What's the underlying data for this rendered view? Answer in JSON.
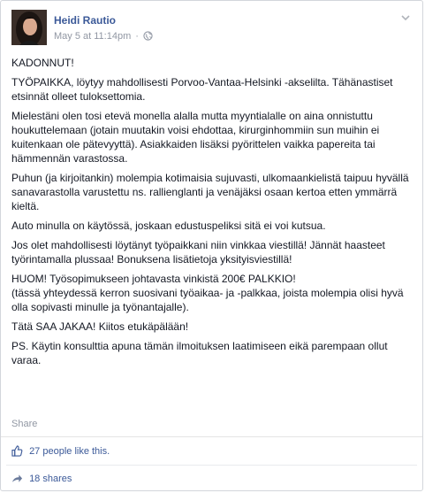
{
  "author": {
    "name": "Heidi Rautio",
    "timestamp": "May 5 at 11:14pm",
    "separator": "·"
  },
  "post": {
    "paragraphs": [
      "KADONNUT!",
      "TYÖPAIKKA, löytyy mahdollisesti Porvoo-Vantaa-Helsinki -akselilta. Tähänastiset etsinnät olleet tuloksettomia.",
      "Mielestäni olen tosi etevä monella alalla mutta myyntialalle on aina onnistuttu houkuttelemaan (jotain muutakin voisi ehdottaa, kirurginhommiin sun muihin ei kuitenkaan ole pätevyyttä). Asiakkaiden lisäksi pyörittelen vaikka papereita tai hämmennän varastossa.",
      "Puhun (ja kirjoitankin) molempia kotimaisia sujuvasti, ulkomaankielistä taipuu hyvällä sanavarastolla varustettu ns. rallienglanti ja venäjäksi osaan kertoa etten ymmärrä kieltä.",
      "Auto minulla on käytössä, joskaan edustuspeliksi sitä ei voi kutsua.",
      "Jos olet mahdollisesti löytänyt työpaikkani niin vinkkaa viestillä! Jännät haasteet työrintamalla plussaa! Bonuksena lisätietoja yksityisviestillä!",
      "HUOM! Työsopimukseen johtavasta vinkistä 200€ PALKKIO!\n(tässä yhteydessä kerron suosivani työaikaa- ja -palkkaa, joista molempia olisi hyvä olla sopivasti minulle ja työnantajalle).",
      "Tätä SAA JAKAA! Kiitos etukäpälään!",
      "PS. Käytin konsulttia apuna tämän ilmoituksen laatimiseen eikä parempaan ollut varaa."
    ]
  },
  "actions": {
    "share_label": "Share"
  },
  "stats": {
    "likes_text": "27 people like this.",
    "shares_text": "18 shares"
  },
  "icons": {
    "globe": "globe-icon",
    "chevron": "chevron-down-icon",
    "like": "thumbs-up-icon",
    "share": "share-arrow-icon"
  },
  "colors": {
    "link": "#3b5998",
    "meta": "#9197a3",
    "text": "#141823",
    "border": "#d3d6db"
  }
}
